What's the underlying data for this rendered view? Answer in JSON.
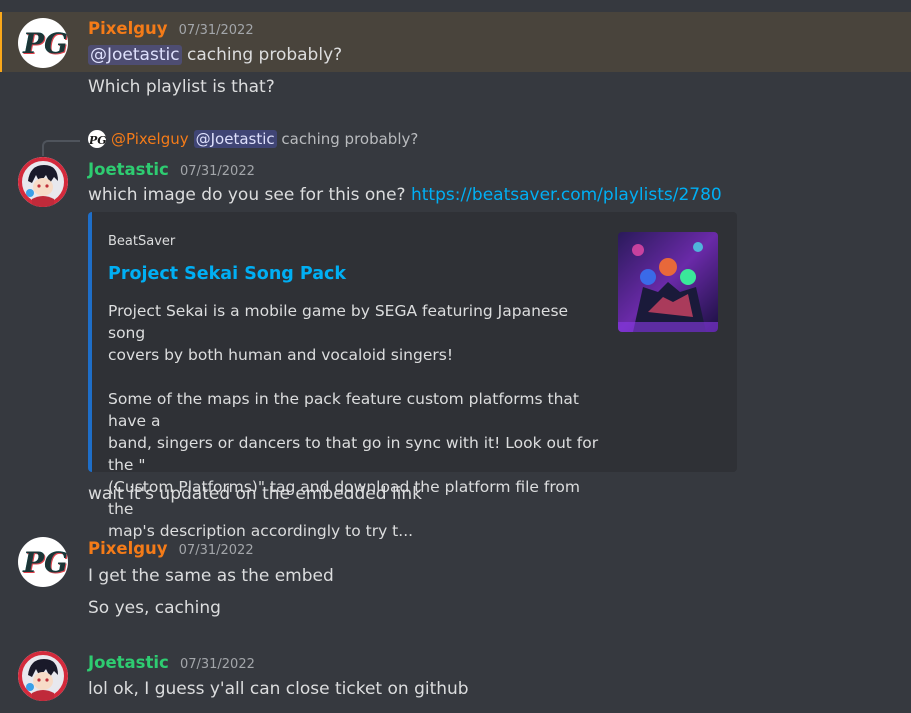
{
  "messages": [
    {
      "username": "Pixelguy",
      "timestamp": "07/31/2022",
      "mention": "@Joetastic",
      "line1_rest": " caching probably?",
      "line2": "Which playlist is that?"
    },
    {
      "reply": {
        "username": "@Pixelguy",
        "mention": "@Joetastic",
        "text": " caching probably?"
      },
      "username": "Joetastic",
      "timestamp": "07/31/2022",
      "line1": "which image do you see for this one? ",
      "link": "https://beatsaver.com/playlists/2780",
      "embed": {
        "provider": "BeatSaver",
        "title": "Project Sekai Song Pack",
        "desc1_l1": "Project Sekai is a mobile game by SEGA featuring Japanese song",
        "desc1_l2": "covers by both human and vocaloid singers!",
        "desc2_l1": "Some of the maps in the pack feature custom platforms that have a",
        "desc2_l2": "band, singers or dancers to that go in sync with it! Look out for the \"",
        "desc2_l3": "(Custom Platforms)\" tag and download the platform file from the",
        "desc2_l4": "map's description accordingly to try t..."
      },
      "line2": "wait it's updated on the embedded link"
    },
    {
      "username": "Pixelguy",
      "timestamp": "07/31/2022",
      "line1": "I get the same as the embed",
      "line2": "So yes, caching"
    },
    {
      "username": "Joetastic",
      "timestamp": "07/31/2022",
      "line1": "lol ok, I guess y'all can close ticket on github"
    }
  ],
  "colors": {
    "pixelguy": "#f47b18",
    "joetastic": "#2ecc71",
    "link": "#00aff4",
    "highlight_border": "#faa81a"
  },
  "icons": {
    "pixelguy_avatar": "pg-logo-avatar",
    "joetastic_avatar": "anime-character-avatar"
  }
}
